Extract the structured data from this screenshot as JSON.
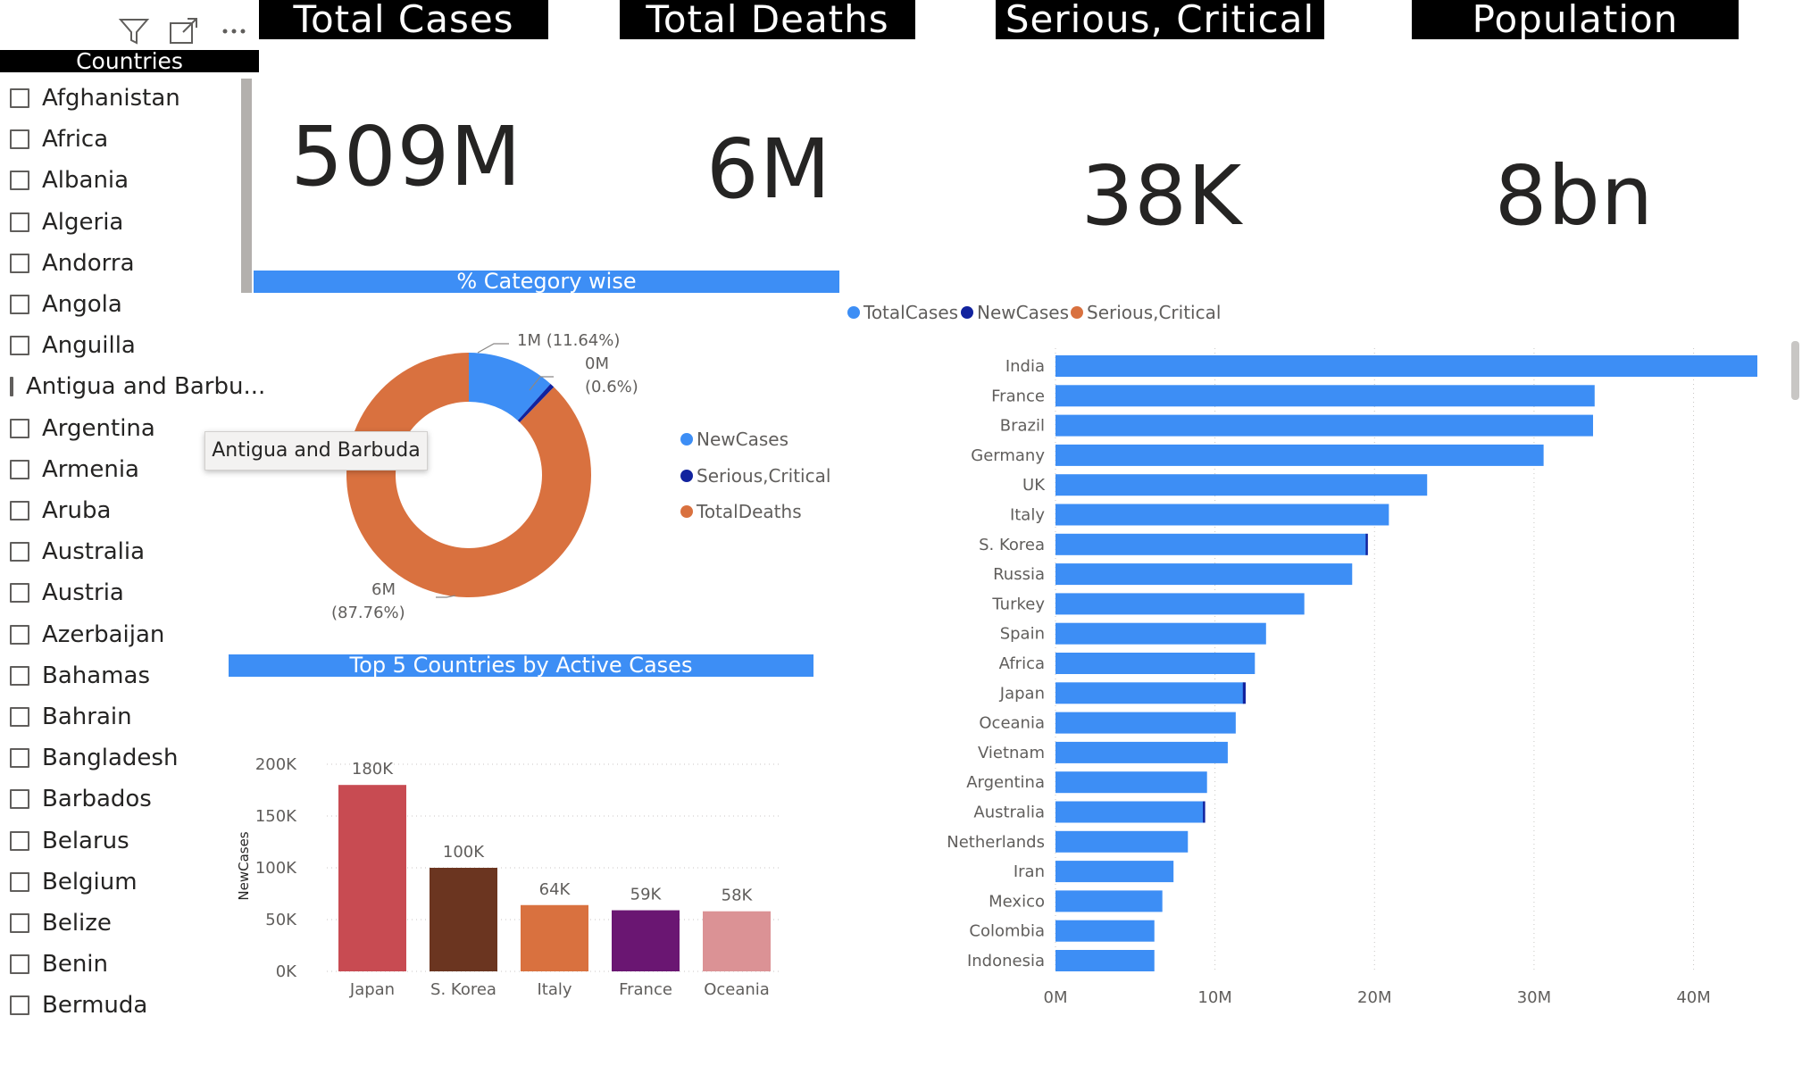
{
  "toolbar": {
    "icons": [
      "filter-icon",
      "focus-mode-icon",
      "more-options-icon"
    ]
  },
  "kpis": [
    {
      "title": "Total Cases",
      "value": "509M"
    },
    {
      "title": "Total Deaths",
      "value": "6M"
    },
    {
      "title": "Serious, Critical",
      "value": "38K"
    },
    {
      "title": "Population",
      "value": "8bn"
    }
  ],
  "slicer": {
    "title": "Countries",
    "items": [
      "Afghanistan",
      "Africa",
      "Albania",
      "Algeria",
      "Andorra",
      "Angola",
      "Anguilla",
      "Antigua and Barbu...",
      "Argentina",
      "Armenia",
      "Aruba",
      "Australia",
      "Austria",
      "Azerbaijan",
      "Bahamas",
      "Bahrain",
      "Bangladesh",
      "Barbados",
      "Belarus",
      "Belgium",
      "Belize",
      "Benin",
      "Bermuda"
    ],
    "tooltip": "Antigua and Barbuda"
  },
  "donut": {
    "title": "% Category wise",
    "legend": [
      "NewCases",
      "Serious,Critical",
      "TotalDeaths"
    ],
    "labels": {
      "new_value": "1M (11.64%)",
      "serious_value": "0M",
      "serious_pct": "(0.6%)",
      "deaths_value": "6M",
      "deaths_pct": "(87.76%)"
    }
  },
  "colors": {
    "blue": "#3d8ef5",
    "navy": "#12239e",
    "orange": "#d9713f",
    "bar_japan": "#c84b52",
    "bar_korea": "#6b3520",
    "bar_italy": "#d9713f",
    "bar_france": "#6a1672",
    "bar_oceania": "#db9295"
  },
  "chart_data": [
    {
      "type": "pie",
      "title": "% Category wise",
      "categories": [
        "NewCases",
        "Serious,Critical",
        "TotalDeaths"
      ],
      "values": [
        11.64,
        0.6,
        87.76
      ],
      "labels": [
        "1M (11.64%)",
        "0M (0.6%)",
        "6M (87.76%)"
      ]
    },
    {
      "type": "bar",
      "title": "Top 5 Countries by Active Cases",
      "ylabel": "NewCases",
      "categories": [
        "Japan",
        "S. Korea",
        "Italy",
        "France",
        "Oceania"
      ],
      "values": [
        180000,
        100000,
        64000,
        59000,
        58000
      ],
      "data_labels": [
        "180K",
        "100K",
        "64K",
        "59K",
        "58K"
      ],
      "yticks": [
        "0K",
        "50K",
        "100K",
        "150K",
        "200K"
      ],
      "ylim": [
        0,
        200000
      ]
    },
    {
      "type": "bar",
      "orientation": "horizontal",
      "legend": [
        "TotalCases",
        "NewCases",
        "Serious,Critical"
      ],
      "categories": [
        "India",
        "France",
        "Brazil",
        "Germany",
        "UK",
        "Italy",
        "S. Korea",
        "Russia",
        "Turkey",
        "Spain",
        "Africa",
        "Japan",
        "Oceania",
        "Vietnam",
        "Argentina",
        "Australia",
        "Netherlands",
        "Iran",
        "Mexico",
        "Colombia",
        "Indonesia"
      ],
      "series": [
        {
          "name": "TotalCases",
          "values": [
            44,
            33.8,
            33.7,
            30.6,
            23.3,
            20.9,
            19.5,
            18.6,
            15.6,
            13.2,
            12.5,
            11.8,
            11.3,
            10.8,
            9.5,
            9.3,
            8.3,
            7.4,
            6.7,
            6.2,
            6.2
          ]
        },
        {
          "name": "NewCases",
          "values": [
            0,
            0,
            0,
            0,
            0,
            0,
            0.12,
            0,
            0,
            0,
            0,
            0.18,
            0,
            0,
            0,
            0.1,
            0,
            0,
            0,
            0,
            0
          ]
        }
      ],
      "xticks": [
        "0M",
        "10M",
        "20M",
        "30M",
        "40M"
      ],
      "xlim": [
        0,
        44
      ]
    }
  ]
}
